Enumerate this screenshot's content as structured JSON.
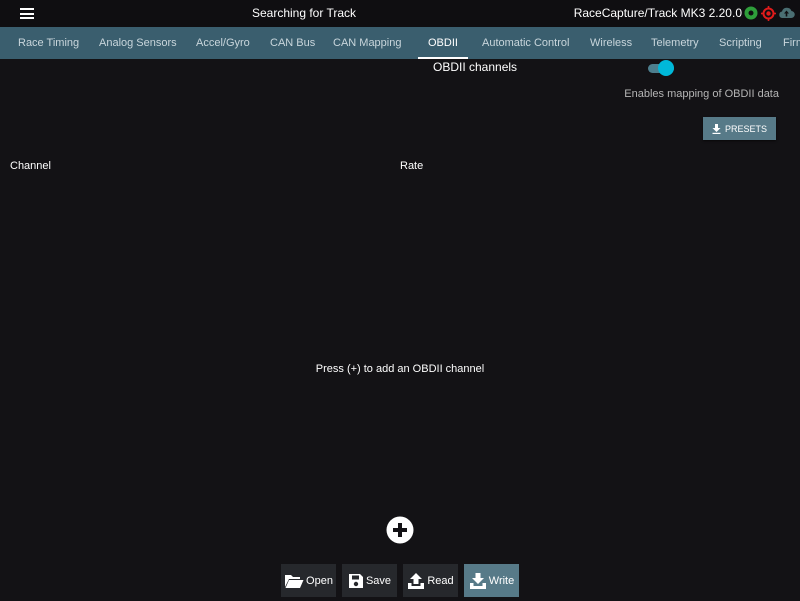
{
  "topbar": {
    "status": "Searching for Track",
    "app_title": "RaceCapture/Track MK3 2.20.0",
    "icons": [
      "menu-icon",
      "gps-status-icon",
      "target-status-icon",
      "cloud-upload-icon"
    ],
    "colors": {
      "gps": "#2e9e3a",
      "target": "#e01b1b",
      "cloud": "#4a6e72"
    }
  },
  "tabs": [
    {
      "label": "Race Timing"
    },
    {
      "label": "Analog Sensors"
    },
    {
      "label": "Accel/Gyro"
    },
    {
      "label": "CAN Bus"
    },
    {
      "label": "CAN Mapping"
    },
    {
      "label": "OBDII",
      "active": true
    },
    {
      "label": "Automatic Control"
    },
    {
      "label": "Wireless"
    },
    {
      "label": "Telemetry"
    },
    {
      "label": "Scripting"
    },
    {
      "label": "Firmware"
    }
  ],
  "obdii": {
    "title": "OBDII channels",
    "toggle_on": true,
    "toggle_description": "Enables mapping of OBDII data",
    "presets_label": "PRESETS",
    "columns": {
      "channel": "Channel",
      "rate": "Rate"
    },
    "empty_hint": "Press (+) to add an OBDII channel"
  },
  "toolbar": {
    "open": "Open",
    "save": "Save",
    "read": "Read",
    "write": "Write"
  },
  "theme": {
    "accent": "#00b8d9",
    "tabbar": "#3a5e6e",
    "button": "#577a88"
  }
}
